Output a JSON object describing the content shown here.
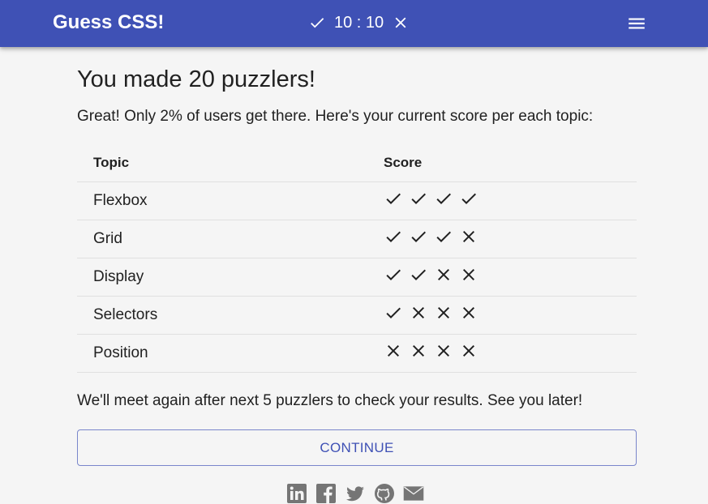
{
  "header": {
    "title": "Guess CSS!",
    "score_text": "10 : 10",
    "correct_icon": "check-icon",
    "wrong_icon": "cross-icon",
    "menu_icon": "hamburger-menu-icon",
    "background_color": "#3f51b5"
  },
  "main": {
    "heading": "You made 20 puzzlers!",
    "intro": "Great! Only 2% of users get there. Here's your current score per each topic:",
    "table": {
      "columns": [
        "Topic",
        "Score"
      ],
      "rows": [
        {
          "topic": "Flexbox",
          "score": [
            "check",
            "check",
            "check",
            "check"
          ]
        },
        {
          "topic": "Grid",
          "score": [
            "check",
            "check",
            "check",
            "cross"
          ]
        },
        {
          "topic": "Display",
          "score": [
            "check",
            "check",
            "cross",
            "cross"
          ]
        },
        {
          "topic": "Selectors",
          "score": [
            "check",
            "cross",
            "cross",
            "cross"
          ]
        },
        {
          "topic": "Position",
          "score": [
            "cross",
            "cross",
            "cross",
            "cross"
          ]
        }
      ]
    },
    "outro": "We'll meet again after next 5 puzzlers to check your results. See you later!",
    "continue_label": "CONTINUE",
    "accent_color": "#3f51b5"
  },
  "share": {
    "icons": [
      "linkedin-icon",
      "facebook-icon",
      "twitter-icon",
      "github-icon",
      "email-icon"
    ]
  }
}
